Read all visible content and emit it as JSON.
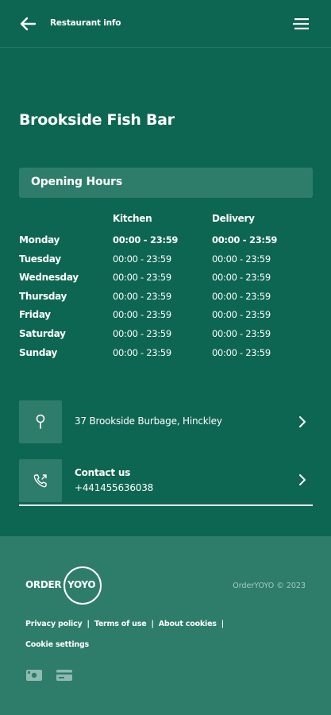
{
  "header": {
    "title": "Restaurant info",
    "back_icon": "arrow-left-icon",
    "menu_icon": "hamburger-menu-icon"
  },
  "restaurant": {
    "name": "Brookside Fish Bar"
  },
  "opening_hours": {
    "section_title": "Opening Hours",
    "columns": {
      "kitchen": "Kitchen",
      "delivery": "Delivery"
    },
    "days": [
      {
        "day": "Monday",
        "kitchen": "00:00 - 23:59",
        "delivery": "00:00 - 23:59"
      },
      {
        "day": "Tuesday",
        "kitchen": "00:00 - 23:59",
        "delivery": "00:00 - 23:59"
      },
      {
        "day": "Wednesday",
        "kitchen": "00:00 - 23:59",
        "delivery": "00:00 - 23:59"
      },
      {
        "day": "Thursday",
        "kitchen": "00:00 - 23:59",
        "delivery": "00:00 - 23:59"
      },
      {
        "day": "Friday",
        "kitchen": "00:00 - 23:59",
        "delivery": "00:00 - 23:59"
      },
      {
        "day": "Saturday",
        "kitchen": "00:00 - 23:59",
        "delivery": "00:00 - 23:59"
      },
      {
        "day": "Sunday",
        "kitchen": "00:00 - 23:59",
        "delivery": "00:00 - 23:59"
      }
    ]
  },
  "address": {
    "text": "37 Brookside Burbage, Hinckley",
    "icon": "map-pin-icon"
  },
  "contact": {
    "title": "Contact us",
    "phone": "+441455636038",
    "icon": "phone-icon"
  },
  "footer": {
    "logo_order": "ORDER",
    "logo_yoyo": "YOYO",
    "copyright": "OrderYOYO © 2023",
    "links": [
      "Privacy policy",
      "Terms of use",
      "About cookies"
    ],
    "separator": "|",
    "cookie_settings": "Cookie settings",
    "payment_icons": [
      "cash-icon",
      "card-icon"
    ]
  },
  "colors": {
    "background": "#0d6652",
    "panel": "#2e7d6b",
    "text": "#ffffff"
  }
}
